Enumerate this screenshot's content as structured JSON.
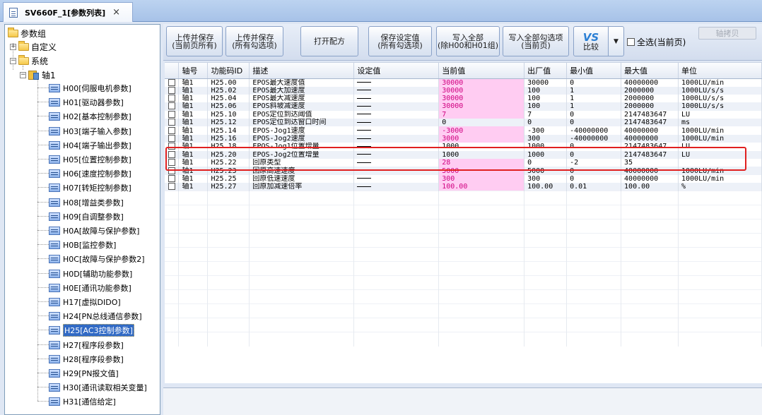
{
  "tab": {
    "title": "SV660F_1[参数列表]",
    "close": "×"
  },
  "tree": {
    "root": "参数组",
    "custom": "自定义",
    "system": "系统",
    "axis": "轴1",
    "items": [
      "H00[伺服电机参数]",
      "H01[驱动器参数]",
      "H02[基本控制参数]",
      "H03[端子输入参数]",
      "H04[端子输出参数]",
      "H05[位置控制参数]",
      "H06[速度控制参数]",
      "H07[转矩控制参数]",
      "H08[增益类参数]",
      "H09[自调整参数]",
      "H0A[故障与保护参数]",
      "H0B[监控参数]",
      "H0C[故障与保护参数2]",
      "H0D[辅助功能参数]",
      "H0E[通讯功能参数]",
      "H17[虚拟DIDO]",
      "H24[PN总线通信参数]",
      "H25[AC3控制参数]",
      "H27[程序段参数]",
      "H28[程序段参数]",
      "H29[PN报文值]",
      "H30[通讯读取相关变量]",
      "H31[通信给定]"
    ],
    "selected_index": 17
  },
  "toolbar": {
    "upload_save_page": [
      "上传并保存",
      "(当前页所有)"
    ],
    "upload_save_checked": [
      "上传并保存",
      "(所有勾选项)"
    ],
    "open_recipe": "打开配方",
    "save_setting": [
      "保存设定值",
      "(所有勾选项)"
    ],
    "write_all": [
      "写入全部",
      "(除H00和H01组)"
    ],
    "write_all_checked": [
      "写入全部勾选项",
      "(当前页)"
    ],
    "compare_logo": "VS",
    "compare": "比较",
    "select_all": "全选(当前页)",
    "copy_axis": "轴拷贝"
  },
  "table": {
    "headers": [
      "",
      "轴号",
      "功能码ID",
      "描述",
      "设定值",
      "当前值",
      "出厂值",
      "最小值",
      "最大值",
      "单位"
    ],
    "rows": [
      [
        "轴1",
        "H25.00",
        "EPOS最大速度值",
        "30000",
        "30000",
        "0",
        "40000000",
        "1000LU/min"
      ],
      [
        "轴1",
        "H25.02",
        "EPOS最大加速度",
        "30000",
        "100",
        "1",
        "2000000",
        "1000LU/s/s"
      ],
      [
        "轴1",
        "H25.04",
        "EPOS最大减速度",
        "30000",
        "100",
        "1",
        "2000000",
        "1000LU/s/s"
      ],
      [
        "轴1",
        "H25.06",
        "EPOS斜坡减速度",
        "30000",
        "100",
        "1",
        "2000000",
        "1000LU/s/s"
      ],
      [
        "轴1",
        "H25.10",
        "EPOS定位到达阈值",
        "7",
        "7",
        "0",
        "2147483647",
        "LU"
      ],
      [
        "轴1",
        "H25.12",
        "EPOS定位到达窗口时间",
        "0",
        "0",
        "0",
        "2147483647",
        "ms"
      ],
      [
        "轴1",
        "H25.14",
        "EPOS-Jog1速度",
        "-3000",
        "-300",
        "-40000000",
        "40000000",
        "1000LU/min"
      ],
      [
        "轴1",
        "H25.16",
        "EPOS-Jog2速度",
        "3000",
        "300",
        "-40000000",
        "40000000",
        "1000LU/min"
      ],
      [
        "轴1",
        "H25.18",
        "EPOS-Jog1位置增量",
        "1000",
        "1000",
        "0",
        "2147483647",
        "LU"
      ],
      [
        "轴1",
        "H25.20",
        "EPOS-Jog2位置增量",
        "1000",
        "1000",
        "0",
        "2147483647",
        "LU"
      ],
      [
        "轴1",
        "H25.22",
        "回原类型",
        "28",
        "0",
        "-2",
        "35",
        ""
      ],
      [
        "轴1",
        "H25.23",
        "回原高速速度",
        "5000",
        "5000",
        "0",
        "40000000",
        "1000LU/min"
      ],
      [
        "轴1",
        "H25.25",
        "回原低速速度",
        "300",
        "300",
        "0",
        "40000000",
        "1000LU/min"
      ],
      [
        "轴1",
        "H25.27",
        "回原加减速倍率",
        "100.00",
        "100.00",
        "0.01",
        "100.00",
        "%"
      ]
    ],
    "pink_current_rows": [
      0,
      1,
      2,
      3,
      4,
      6,
      7,
      10,
      11,
      12,
      13
    ]
  }
}
